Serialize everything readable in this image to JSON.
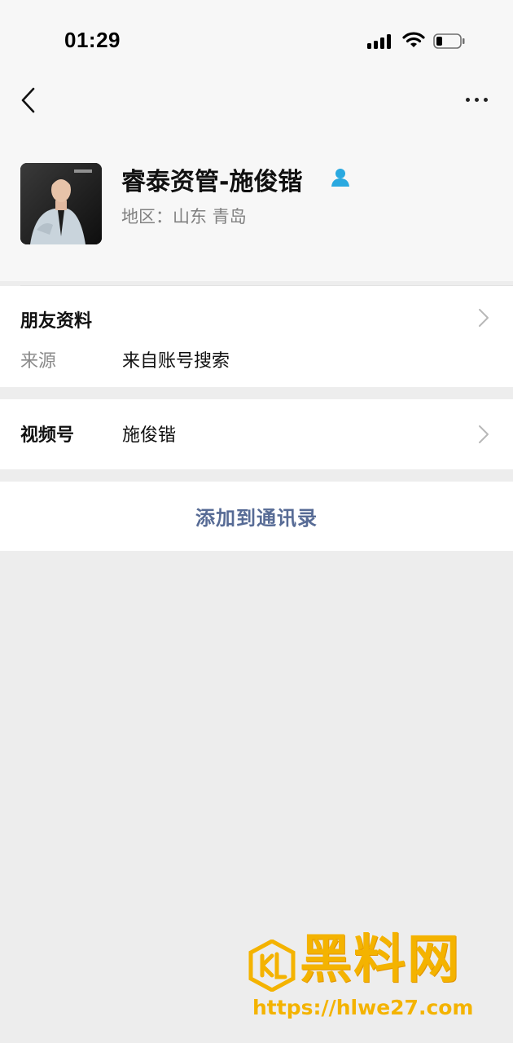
{
  "status_bar": {
    "time": "01:29"
  },
  "nav": {
    "back_icon": "chevron-left-icon",
    "more_icon": "more-dots-icon"
  },
  "profile": {
    "name": "睿泰资管-施俊锴",
    "region": "地区：山东 青岛",
    "badge_icon": "person-badge-icon",
    "badge_color": "#2aa9e0"
  },
  "friend_info": {
    "title": "朋友资料",
    "source_label": "来源",
    "source_value": "来自账号搜索"
  },
  "channels": {
    "label": "视频号",
    "value": "施俊锴"
  },
  "actions": {
    "add_contact": "添加到通讯录",
    "link_color": "#576b95"
  },
  "watermark": {
    "title": "黑料网",
    "url": "https://hlwe27.com",
    "color": "#f4b300"
  }
}
